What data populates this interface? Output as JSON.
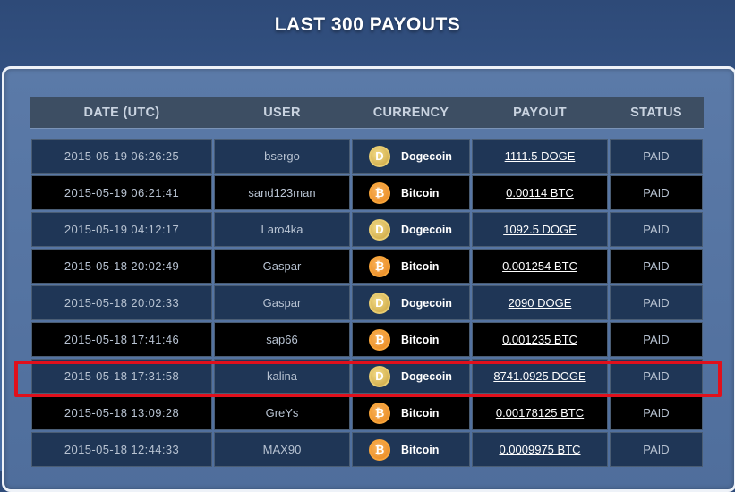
{
  "title": "LAST 300 PAYOUTS",
  "columns": [
    "DATE (UTC)",
    "USER",
    "CURRENCY",
    "PAYOUT",
    "STATUS"
  ],
  "rows": [
    {
      "date": "2015-05-19 06:26:25",
      "user": "bsergo",
      "currency": "Dogecoin",
      "coin_icon": "dogecoin-icon",
      "coin_glyph": "D",
      "payout": "1111.5 DOGE",
      "status": "PAID"
    },
    {
      "date": "2015-05-19 06:21:41",
      "user": "sand123man",
      "currency": "Bitcoin",
      "coin_icon": "bitcoin-icon",
      "coin_glyph": "₿",
      "payout": "0.00114 BTC",
      "status": "PAID"
    },
    {
      "date": "2015-05-19 04:12:17",
      "user": "Laro4ka",
      "currency": "Dogecoin",
      "coin_icon": "dogecoin-icon",
      "coin_glyph": "D",
      "payout": "1092.5 DOGE",
      "status": "PAID"
    },
    {
      "date": "2015-05-18 20:02:49",
      "user": "Gaspar",
      "currency": "Bitcoin",
      "coin_icon": "bitcoin-icon",
      "coin_glyph": "₿",
      "payout": "0.001254 BTC",
      "status": "PAID"
    },
    {
      "date": "2015-05-18 20:02:33",
      "user": "Gaspar",
      "currency": "Dogecoin",
      "coin_icon": "dogecoin-icon",
      "coin_glyph": "D",
      "payout": "2090 DOGE",
      "status": "PAID"
    },
    {
      "date": "2015-05-18 17:41:46",
      "user": "sap66",
      "currency": "Bitcoin",
      "coin_icon": "bitcoin-icon",
      "coin_glyph": "₿",
      "payout": "0.001235 BTC",
      "status": "PAID"
    },
    {
      "date": "2015-05-18 17:31:58",
      "user": "kalina",
      "currency": "Dogecoin",
      "coin_icon": "dogecoin-icon",
      "coin_glyph": "D",
      "payout": "8741.0925 DOGE",
      "status": "PAID"
    },
    {
      "date": "2015-05-18 13:09:28",
      "user": "GreYs",
      "currency": "Bitcoin",
      "coin_icon": "bitcoin-icon",
      "coin_glyph": "₿",
      "payout": "0.00178125 BTC",
      "status": "PAID"
    },
    {
      "date": "2015-05-18 12:44:33",
      "user": "MAX90",
      "currency": "Bitcoin",
      "coin_icon": "bitcoin-icon",
      "coin_glyph": "₿",
      "payout": "0.0009975 BTC",
      "status": "PAID"
    }
  ],
  "highlighted_row_index": 6,
  "colors": {
    "highlight": "#e0101c",
    "row_blue": "#1f3656",
    "row_black": "#000000",
    "header": "#3d4e63"
  }
}
